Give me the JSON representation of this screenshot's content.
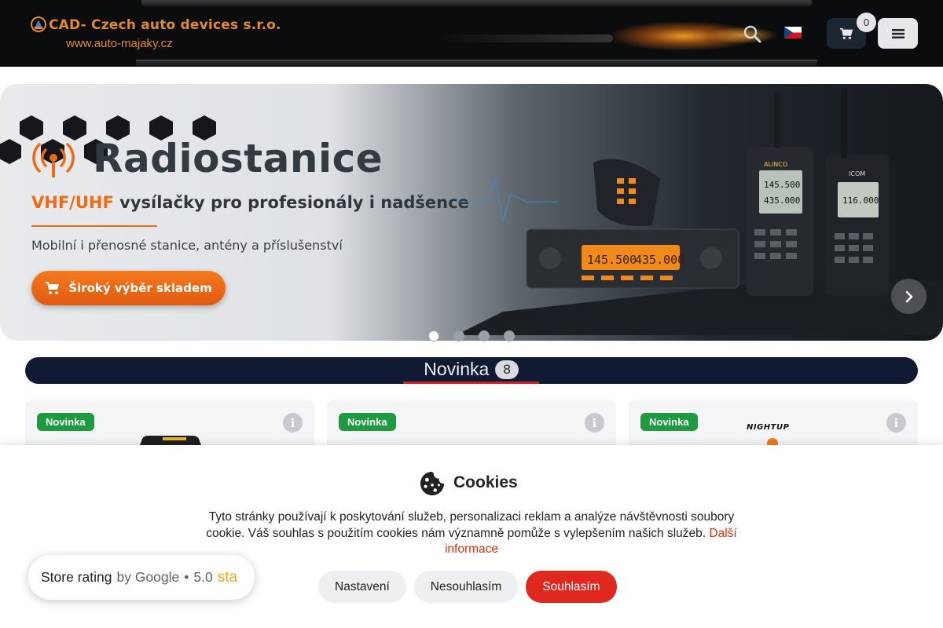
{
  "header": {
    "logo_title": "CAD- Czech auto devices s.r.o.",
    "logo_url": "www.auto-majaky.cz",
    "cart_count": "0"
  },
  "banner": {
    "title": "Radiostanice",
    "subtitle_highlight": "VHF/UHF",
    "subtitle_rest": "vysílačky pro profesionály i nadšence",
    "description": "Mobilní i přenosné stanice, antény a příslušenství",
    "cta_label": "Široký výběr skladem",
    "display_freq_a": "145.500",
    "display_freq_b": "435.000",
    "brand_alinco": "ALINCO",
    "brand_icom": "ICOM",
    "slides": 4,
    "active_slide": 1
  },
  "section": {
    "title": "Novinka",
    "count": "8"
  },
  "products": [
    {
      "badge": "Novinka"
    },
    {
      "badge": "Novinka"
    },
    {
      "badge": "Novinka",
      "brand": "NIGHTUP"
    }
  ],
  "cookies": {
    "title": "Cookies",
    "text": "Tyto stránky používají k poskytování služeb, personalizaci reklam a analýze návštěvnosti soubory cookie. Váš souhlas s použitím cookies nám významně pomůže s vylepšením našich služeb.",
    "more_link": "Další informace",
    "btn_settings": "Nastavení",
    "btn_reject": "Nesouhlasím",
    "btn_accept": "Souhlasím"
  },
  "rating": {
    "label": "Store rating",
    "by": "by Google",
    "score": "5.0",
    "stars_text": "sta"
  },
  "colors": {
    "accent_orange": "#ee6a14",
    "accept_red": "#e0281e",
    "badge_green": "#1e9a40",
    "section_navy": "#101a33"
  }
}
